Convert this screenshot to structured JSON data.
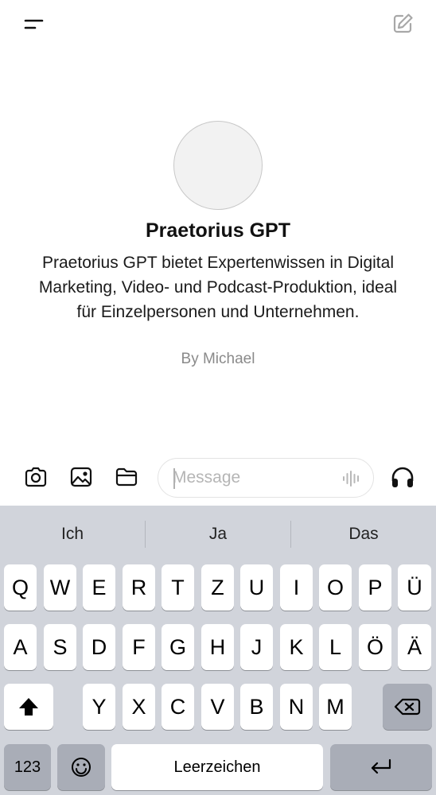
{
  "header": {
    "menu_icon": "menu-icon",
    "new_chat_icon": "edit-icon"
  },
  "gpt": {
    "name": "Praetorius GPT",
    "description": "Praetorius GPT bietet Expertenwissen in Digital Marketing, Video- und Podcast-Produktion, ideal für Einzelpersonen und Unternehmen.",
    "author": "By Michael"
  },
  "composer": {
    "placeholder": "Message",
    "tools": [
      "camera-icon",
      "photo-icon",
      "folder-icon"
    ],
    "voice_icon": "waveform-icon",
    "audio_icon": "headphones-icon"
  },
  "keyboard": {
    "suggestions": [
      "Ich",
      "Ja",
      "Das"
    ],
    "row1": [
      "Q",
      "W",
      "E",
      "R",
      "T",
      "Z",
      "U",
      "I",
      "O",
      "P",
      "Ü"
    ],
    "row2": [
      "A",
      "S",
      "D",
      "F",
      "G",
      "H",
      "J",
      "K",
      "L",
      "Ö",
      "Ä"
    ],
    "row3": [
      "Y",
      "X",
      "C",
      "V",
      "B",
      "N",
      "M"
    ],
    "numbers_label": "123",
    "space_label": "Leerzeichen",
    "shift_icon": "shift-icon",
    "backspace_icon": "backspace-icon",
    "emoji_icon": "emoji-icon",
    "return_icon": "return-icon"
  }
}
